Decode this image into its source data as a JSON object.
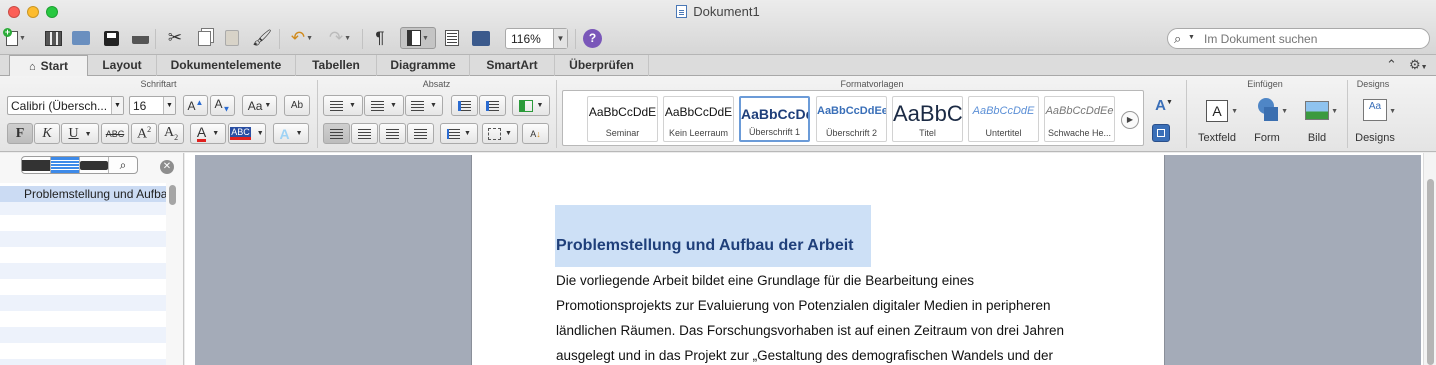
{
  "window": {
    "title": "Dokument1"
  },
  "toolbar": {
    "zoom": "116%",
    "search_placeholder": "Im Dokument suchen",
    "help_label": "?"
  },
  "tabs": [
    "Start",
    "Layout",
    "Dokumentelemente",
    "Tabellen",
    "Diagramme",
    "SmartArt",
    "Überprüfen"
  ],
  "ribbon": {
    "groups": {
      "schriftart": "Schriftart",
      "absatz": "Absatz",
      "formatvorlagen": "Formatvorlagen",
      "einfuegen": "Einfügen",
      "designs": "Designs"
    },
    "font_name": "Calibri (Übersch...",
    "font_size": "16",
    "styles": [
      {
        "sample": "AaBbCcDdE",
        "name": "Seminar"
      },
      {
        "sample": "AaBbCcDdE",
        "name": "Kein Leerraum"
      },
      {
        "sample": "AaBbCcDd",
        "name": "Überschrift 1"
      },
      {
        "sample": "AaBbCcDdEe",
        "name": "Überschrift 2"
      },
      {
        "sample": "AaBbC",
        "name": "Titel"
      },
      {
        "sample": "AaBbCcDdE",
        "name": "Untertitel"
      },
      {
        "sample": "AaBbCcDdEe",
        "name": "Schwache He..."
      }
    ],
    "insert_buttons": [
      "Textfeld",
      "Form",
      "Bild"
    ],
    "designs_button": "Designs",
    "accent_color": "#3d8ae9"
  },
  "navigation": {
    "items": [
      "Problemstellung und Aufbau der Arbeit"
    ]
  },
  "document": {
    "heading": "Problemstellung und Aufbau der Arbeit",
    "lines": [
      "Die vorliegende Arbeit bildet eine Grundlage für die Bearbeitung eines",
      "Promotionsprojekts zur Evaluierung von Potenzialen digitaler Medien in peripheren",
      "ländlichen Räumen. Das Forschungsvorhaben ist auf einen Zeitraum von drei Jahren",
      "ausgelegt und in das Projekt zur „Gestaltung des demografischen Wandels und der"
    ]
  }
}
